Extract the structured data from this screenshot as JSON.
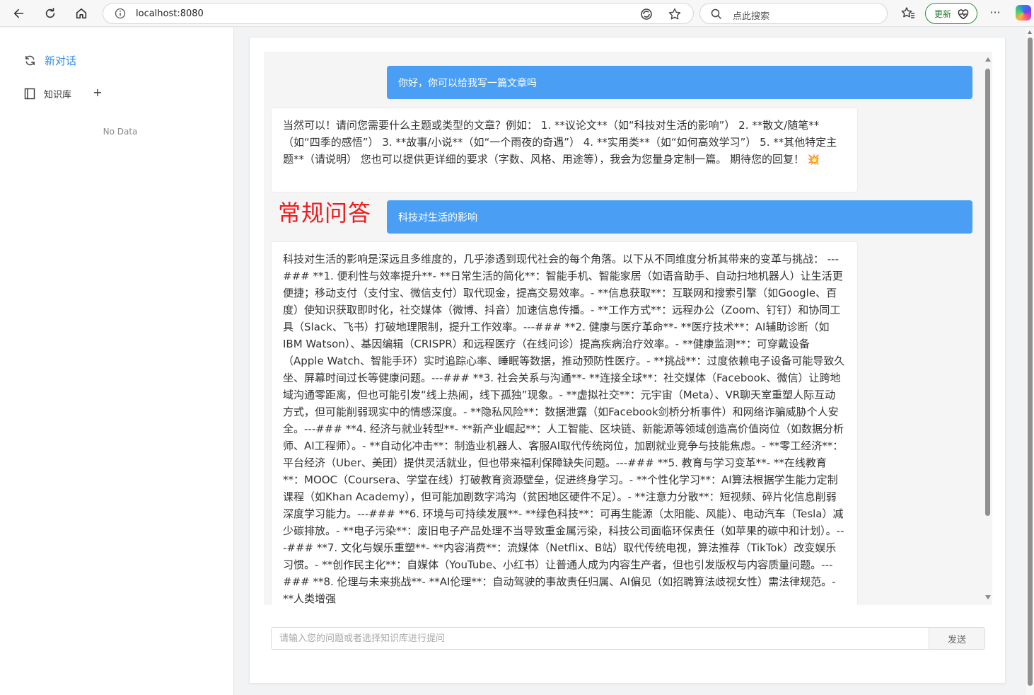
{
  "browser": {
    "url": "localhost:8080",
    "search_placeholder": "点此搜索",
    "update_label": "更新",
    "more_label": "···"
  },
  "sidebar": {
    "new_chat_label": "新对话",
    "knowledge_base_label": "知识库",
    "add_label": "+",
    "empty_text": "No Data"
  },
  "annotation": "常规问答",
  "messages": {
    "user_1": "你好，你可以给我写一篇文章吗",
    "ai_1": "当然可以！请问您需要什么主题或类型的文章？例如： 1. **议论文**（如“科技对生活的影响”） 2. **散文/随笔**（如“四季的感悟”） 3. **故事/小说**（如“一个雨夜的奇遇”） 4. **实用类**（如“如何高效学习”） 5. **其他特定主题**（请说明） 您也可以提供更详细的要求（字数、风格、用途等），我会为您量身定制一篇。 期待您的回复！",
    "ai_1_emoji": "💥",
    "user_2": "科技对生活的影响",
    "ai_2": "科技对生活的影响是深远且多维度的，几乎渗透到现代社会的每个角落。以下从不同维度分析其带来的变革与挑战： ---### **1. 便利性与效率提升**- **日常生活的简化**：智能手机、智能家居（如语音助手、自动扫地机器人）让生活更便捷；移动支付（支付宝、微信支付）取代现金，提高交易效率。- **信息获取**：互联网和搜索引擎（如Google、百度）使知识获取即时化，社交媒体（微博、抖音）加速信息传播。- **工作方式**：远程办公（Zoom、钉钉）和协同工具（Slack、飞书）打破地理限制，提升工作效率。---### **2. 健康与医疗革命**- **医疗技术**：AI辅助诊断（如IBM Watson）、基因编辑（CRISPR）和远程医疗（在线问诊）提高疾病治疗效率。- **健康监测**：可穿戴设备（Apple Watch、智能手环）实时追踪心率、睡眠等数据，推动预防性医疗。- **挑战**：过度依赖电子设备可能导致久坐、屏幕时间过长等健康问题。---### **3. 社会关系与沟通**- **连接全球**：社交媒体（Facebook、微信）让跨地域沟通零距离，但也可能引发“线上热闹，线下孤独”现象。- **虚拟社交**：元宇宙（Meta）、VR聊天室重塑人际互动方式，但可能削弱现实中的情感深度。- **隐私风险**：数据泄露（如Facebook剑桥分析事件）和网络诈骗威胁个人安全。---### **4. 经济与就业转型**- **新产业崛起**：人工智能、区块链、新能源等领域创造高价值岗位（如数据分析师、AI工程师）。- **自动化冲击**：制造业机器人、客服AI取代传统岗位，加剧就业竞争与技能焦虑。- **零工经济**：平台经济（Uber、美团）提供灵活就业，但也带来福利保障缺失问题。---### **5. 教育与学习变革**- **在线教育**：MOOC（Coursera、学堂在线）打破教育资源壁垒，促进终身学习。- **个性化学习**：AI算法根据学生能力定制课程（如Khan Academy），但可能加剧数字鸿沟（贫困地区硬件不足）。- **注意力分散**：短视频、碎片化信息削弱深度学习能力。---### **6. 环境与可持续发展**- **绿色科技**：可再生能源（太阳能、风能）、电动汽车（Tesla）减少碳排放。- **电子污染**：废旧电子产品处理不当导致重金属污染，科技公司面临环保责任（如苹果的碳中和计划）。---### **7. 文化与娱乐重塑**- **内容消费**：流媒体（Netflix、B站）取代传统电视，算法推荐（TikTok）改变娱乐习惯。- **创作民主化**：自媒体（YouTube、小红书）让普通人成为内容生产者，但也引发版权与内容质量问题。---### **8. 伦理与未来挑战**- **AI伦理**：自动驾驶的事故责任归属、AI偏见（如招聘算法歧视女性）需法律规范。- **人类增强"
  },
  "composer": {
    "placeholder": "请输入您的问题或者选择知识库进行提问",
    "send_label": "发送"
  }
}
